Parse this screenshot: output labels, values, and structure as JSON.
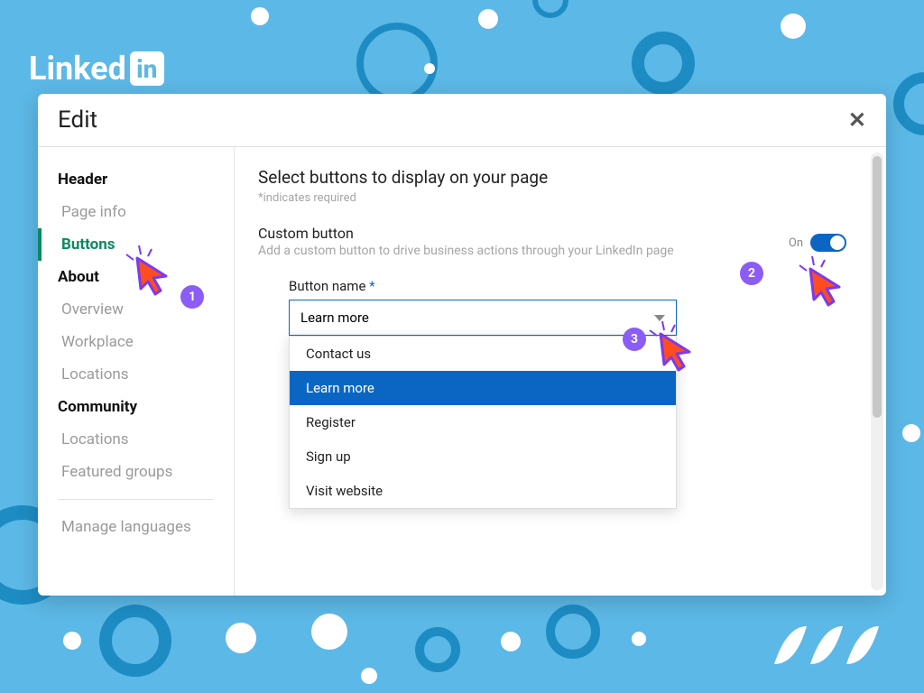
{
  "brand": {
    "linked": "Linked",
    "in": "in"
  },
  "modal": {
    "title": "Edit",
    "sidebar": {
      "sections": [
        {
          "head": "Header",
          "items": [
            "Page info",
            "Buttons"
          ],
          "active_index": 1
        },
        {
          "head": "About",
          "items": [
            "Overview",
            "Workplace",
            "Locations"
          ]
        },
        {
          "head": "Community",
          "items": [
            "Locations",
            "Featured groups"
          ]
        }
      ],
      "footer_item": "Manage languages"
    },
    "content": {
      "title": "Select buttons to display on your page",
      "required_note": "*indicates required",
      "custom": {
        "title": "Custom button",
        "desc": "Add a custom button to drive business actions through your LinkedIn page",
        "toggle_label": "On"
      },
      "field": {
        "label": "Button name",
        "required_mark": "*",
        "value": "Learn more",
        "options": [
          "Contact us",
          "Learn more",
          "Register",
          "Sign up",
          "Visit website"
        ],
        "selected_index": 1
      }
    }
  },
  "annotations": {
    "steps": [
      "1",
      "2",
      "3"
    ]
  }
}
